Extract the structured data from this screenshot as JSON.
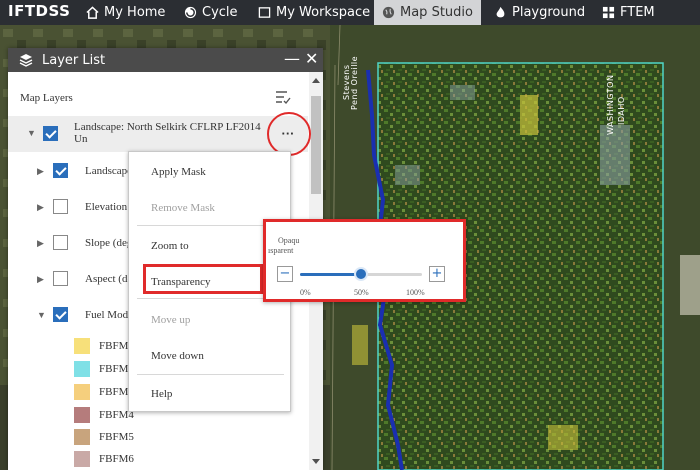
{
  "nav": {
    "brand": "IFTDSS",
    "items": [
      {
        "label": "My Home",
        "icon": "home-icon"
      },
      {
        "label": "Cycle",
        "icon": "cycle-icon"
      },
      {
        "label": "My Workspace",
        "icon": "workspace-icon"
      },
      {
        "label": "Map Studio",
        "icon": "globe-icon",
        "active": true
      },
      {
        "label": "Playground",
        "icon": "fire-icon"
      },
      {
        "label": "FTEM",
        "icon": "grid-icon"
      }
    ]
  },
  "map": {
    "labels": {
      "county_a": "Stevens",
      "county_b": "Pend Oreille",
      "state_a": "WASHINGTON",
      "state_b": "IDAHO"
    }
  },
  "panel": {
    "title": "Layer List",
    "section_title": "Map Layers",
    "layers": [
      {
        "label": "Landscape: North Selkirk CFLRP LF2014 Un",
        "checked": true
      },
      {
        "label": "Landscape",
        "checked": true
      },
      {
        "label": "Elevation",
        "checked": false
      },
      {
        "label": "Slope (deg",
        "checked": false
      },
      {
        "label": "Aspect (de",
        "checked": false
      },
      {
        "label": "Fuel Mode",
        "checked": true
      }
    ],
    "legend": [
      {
        "label": "FBFM",
        "color": "#f7e07a"
      },
      {
        "label": "FBFM",
        "color": "#7fe0e6"
      },
      {
        "label": "FBFM",
        "color": "#f5cf7d"
      },
      {
        "label": "FBFM4",
        "color": "#b57c7c"
      },
      {
        "label": "FBFM5",
        "color": "#c8a47d"
      },
      {
        "label": "FBFM6",
        "color": "#c9a9a6"
      }
    ],
    "more_glyph": "···"
  },
  "context_menu": {
    "items": [
      {
        "label": "Apply Mask",
        "enabled": true
      },
      {
        "label": "Remove Mask",
        "enabled": false
      },
      {
        "label": "Zoom to",
        "enabled": true
      },
      {
        "label": "Transparency",
        "enabled": true
      },
      {
        "label": "Move up",
        "enabled": false
      },
      {
        "label": "Move down",
        "enabled": true
      },
      {
        "label": "Help",
        "enabled": true
      }
    ]
  },
  "transparency": {
    "label_opaque": "Opaqu",
    "label_transparent": "ısparent",
    "minus": "−",
    "plus": "+",
    "value_fraction": 0.5,
    "ticks": [
      "0%",
      "50%",
      "100%"
    ]
  },
  "colors": {
    "accent": "#2a6ebb",
    "highlight_red": "#e02a2a",
    "nav_bg": "#2b2e33",
    "panel_header": "#4b4b4b"
  }
}
